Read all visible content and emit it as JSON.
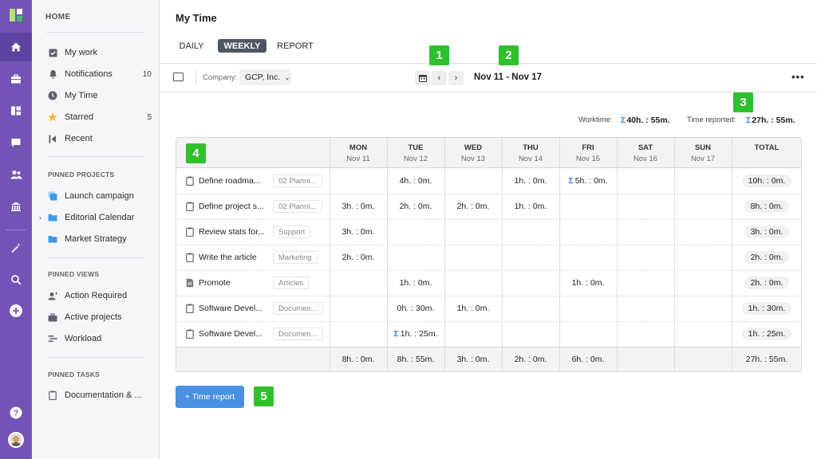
{
  "rail": {
    "items": [
      {
        "icon": "home-icon"
      },
      {
        "icon": "briefcase-icon"
      },
      {
        "icon": "dashboard-icon"
      },
      {
        "icon": "chat-icon"
      },
      {
        "icon": "users-icon"
      },
      {
        "icon": "bank-icon"
      },
      {
        "icon": "magic-wand-icon"
      },
      {
        "icon": "search-icon"
      },
      {
        "icon": "add-icon"
      },
      {
        "icon": "help-icon"
      }
    ],
    "active": "home-icon"
  },
  "sidebar": {
    "home_label": "HOME",
    "home_items": [
      {
        "label": "My work",
        "icon": "checkbox-icon",
        "count": ""
      },
      {
        "label": "Notifications",
        "icon": "bell-icon",
        "count": "10"
      },
      {
        "label": "My Time",
        "icon": "clock-icon",
        "count": ""
      },
      {
        "label": "Starred",
        "icon": "star-icon",
        "count": "5"
      },
      {
        "label": "Recent",
        "icon": "recent-icon",
        "count": ""
      }
    ],
    "pinned_projects_label": "PINNED PROJECTS",
    "pinned_projects": [
      {
        "label": "Launch campaign",
        "icon": "project-copy-icon"
      },
      {
        "label": "Editorial Calendar",
        "icon": "folder-icon"
      },
      {
        "label": "Market Strategy",
        "icon": "folder-icon"
      }
    ],
    "pinned_views_label": "PINNED VIEWS",
    "pinned_views": [
      {
        "label": "Action Required",
        "icon": "user-action-icon"
      },
      {
        "label": "Active projects",
        "icon": "briefcase-icon"
      },
      {
        "label": "Workload",
        "icon": "workload-icon"
      }
    ],
    "pinned_tasks_label": "PINNED TASKS",
    "pinned_tasks": [
      {
        "label": "Documentation & ...",
        "icon": "task-icon"
      }
    ]
  },
  "main": {
    "title": "My Time",
    "tabs": [
      "DAILY",
      "WEEKLY",
      "REPORT"
    ],
    "selected_tab": "WEEKLY",
    "company_label": "Company:",
    "company_value": "GCP, Inc.",
    "date_range": "Nov 11 - Nov 17",
    "worktime_label": "Worktime:",
    "worktime_value": "40h. : 55m.",
    "reported_label": "Time reported:",
    "reported_value": "27h. : 55m.",
    "time_report_button": "+ Time report",
    "badges": [
      "1",
      "2",
      "3",
      "4",
      "5"
    ]
  },
  "table": {
    "days": [
      {
        "name": "MON",
        "date": "Nov 11"
      },
      {
        "name": "TUE",
        "date": "Nov 12"
      },
      {
        "name": "WED",
        "date": "Nov 13"
      },
      {
        "name": "THU",
        "date": "Nov 14"
      },
      {
        "name": "FRI",
        "date": "Nov 15"
      },
      {
        "name": "SAT",
        "date": "Nov 16"
      },
      {
        "name": "SUN",
        "date": "Nov 17"
      }
    ],
    "total_header": "TOTAL",
    "rows": [
      {
        "task": "Define roadma...",
        "tag": "02 Planni...",
        "icon": "task-icon",
        "cells": [
          "",
          "4h. : 0m.",
          "",
          "1h. : 0m.",
          "5h. : 0m.",
          "",
          ""
        ],
        "sigma": [
          false,
          false,
          false,
          false,
          true,
          false,
          false
        ],
        "total": "10h. : 0m."
      },
      {
        "task": "Define project s...",
        "tag": "02 Planni...",
        "icon": "task-icon",
        "cells": [
          "3h. : 0m.",
          "2h. : 0m.",
          "2h. : 0m.",
          "1h. : 0m.",
          "",
          "",
          ""
        ],
        "sigma": [
          false,
          false,
          false,
          false,
          false,
          false,
          false
        ],
        "total": "8h. : 0m."
      },
      {
        "task": "Review stats for...",
        "tag": "Support",
        "icon": "task-icon",
        "cells": [
          "3h. : 0m.",
          "",
          "",
          "",
          "",
          "",
          ""
        ],
        "sigma": [
          false,
          false,
          false,
          false,
          false,
          false,
          false
        ],
        "total": "3h. : 0m."
      },
      {
        "task": "Write the article",
        "tag": "Marketing",
        "icon": "task-icon",
        "cells": [
          "2h. : 0m.",
          "",
          "",
          "",
          "",
          "",
          ""
        ],
        "sigma": [
          false,
          false,
          false,
          false,
          false,
          false,
          false
        ],
        "total": "2h. : 0m."
      },
      {
        "task": "Promote",
        "tag": "Articles",
        "icon": "document-icon",
        "cells": [
          "",
          "1h. : 0m.",
          "",
          "",
          "1h. : 0m.",
          "",
          ""
        ],
        "sigma": [
          false,
          false,
          false,
          false,
          false,
          false,
          false
        ],
        "total": "2h. : 0m."
      },
      {
        "task": "Software Devel...",
        "tag": "Documen...",
        "icon": "task-icon",
        "cells": [
          "",
          "0h. : 30m.",
          "1h. : 0m.",
          "",
          "",
          "",
          ""
        ],
        "sigma": [
          false,
          false,
          false,
          false,
          false,
          false,
          false
        ],
        "total": "1h. : 30m."
      },
      {
        "task": "Software Devel...",
        "tag": "Documen...",
        "icon": "task-icon",
        "cells": [
          "",
          "1h. : 25m.",
          "",
          "",
          "",
          "",
          ""
        ],
        "sigma": [
          false,
          true,
          false,
          false,
          false,
          false,
          false
        ],
        "total": "1h. : 25m."
      }
    ],
    "footer": [
      "8h. : 0m.",
      "8h. : 55m.",
      "3h. : 0m.",
      "2h. : 0m.",
      "6h. : 0m.",
      "",
      ""
    ],
    "footer_total": "27h. : 55m."
  }
}
